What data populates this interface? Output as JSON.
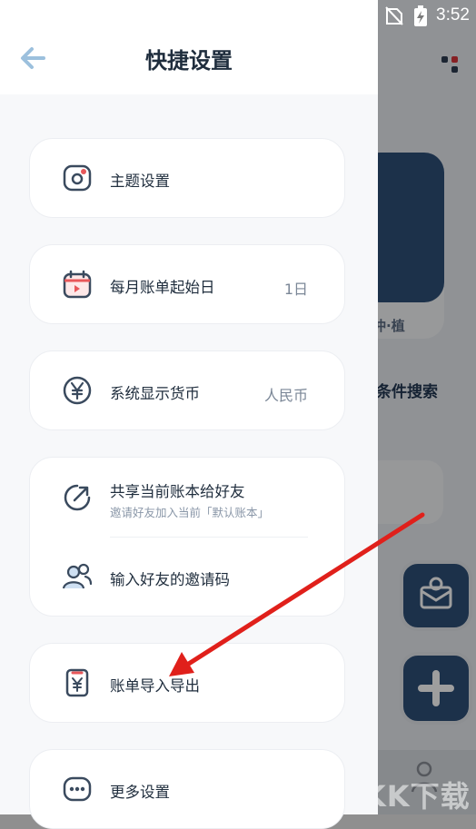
{
  "status_bar": {
    "time": "3:52"
  },
  "drawer": {
    "title": "快捷设置",
    "groups": [
      {
        "items": [
          {
            "label": "主题设置",
            "value": ""
          }
        ]
      },
      {
        "items": [
          {
            "label": "每月账单起始日",
            "value": "1日"
          }
        ]
      },
      {
        "items": [
          {
            "label": "系统显示货币",
            "value": "人民币"
          }
        ]
      },
      {
        "items": [
          {
            "label": "共享当前账本给好友",
            "sublabel": "邀请好友加入当前「默认账本」"
          },
          {
            "label": "输入好友的邀请码"
          }
        ]
      },
      {
        "items": [
          {
            "label": "账单导入导出"
          }
        ]
      },
      {
        "items": [
          {
            "label": "更多设置"
          }
        ]
      }
    ]
  },
  "background_app": {
    "card_label": "冲·植",
    "search_label": "条件搜索"
  },
  "watermark": "KK下载",
  "colors": {
    "accent": "#2e4f78",
    "annotation_arrow": "#e0201b",
    "back_arrow": "#9cc0dd"
  }
}
